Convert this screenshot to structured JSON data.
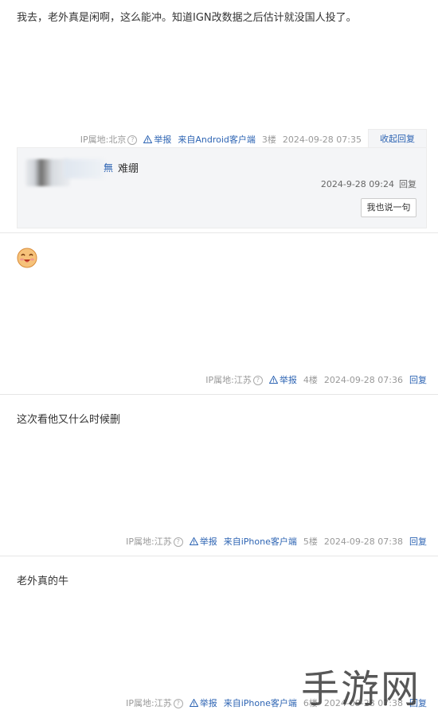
{
  "posts": [
    {
      "text": "我去，老外真是闲啊，这么能冲。知道IGN改数据之后估计就没国人投了。",
      "ip_label": "IP属地:北京",
      "report": "举报",
      "source": "来自Android客户端",
      "floor": "3楼",
      "time": "2024-09-28 07:35",
      "action": "收起回复",
      "reply": {
        "user": "無",
        "text": "难绷",
        "time": "2024-9-28 09:24",
        "reply_label": "回复",
        "say_button": "我也说一句"
      }
    },
    {
      "emoji": "smiling-face-emoji",
      "ip_label": "IP属地:江苏",
      "report": "举报",
      "floor": "4楼",
      "time": "2024-09-28 07:36",
      "action": "回复"
    },
    {
      "text": "这次看他又什么时候删",
      "ip_label": "IP属地:江苏",
      "report": "举报",
      "source": "来自iPhone客户端",
      "floor": "5楼",
      "time": "2024-09-28 07:38",
      "action": "回复"
    },
    {
      "text": "老外真的牛",
      "ip_label": "IP属地:江苏",
      "report": "举报",
      "source": "来自iPhone客户端",
      "floor": "6楼",
      "time": "2024-09-28 07:38",
      "action": "回复"
    }
  ],
  "watermark": "手游网",
  "colors": {
    "link": "#2d64b3",
    "meta": "#999999",
    "reply_bg": "#f4f5f7"
  }
}
